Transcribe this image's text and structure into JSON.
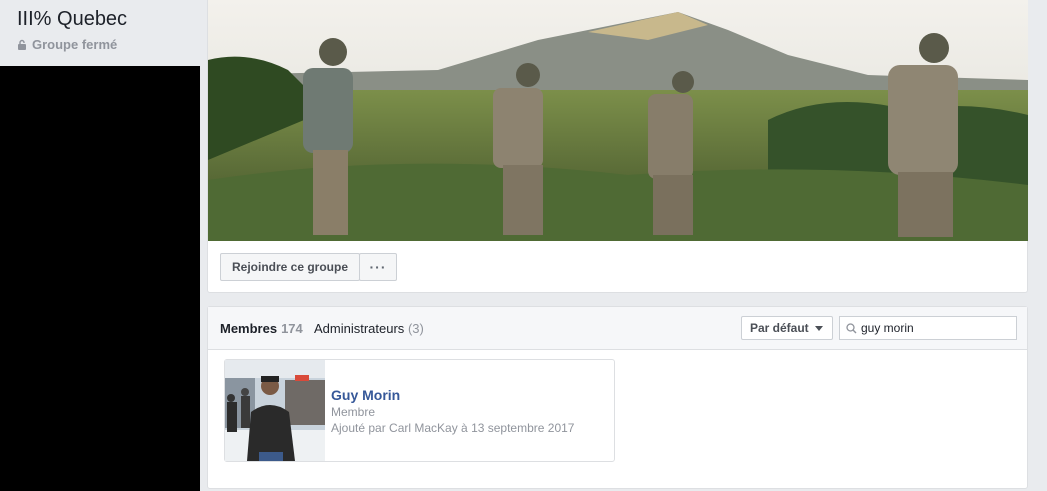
{
  "group": {
    "name": "III% Quebec",
    "privacy": "Groupe fermé",
    "join_label": "Rejoindre ce groupe",
    "more_label": "···"
  },
  "members": {
    "tab_members_label": "Membres",
    "members_count": "174",
    "tab_admins_label": "Administrateurs",
    "admins_count": "(3)",
    "sort_label": "Par défaut",
    "search_value": "guy morin",
    "results": [
      {
        "name": "Guy Morin",
        "role": "Membre",
        "added": "Ajouté par Carl MacKay à 13 septembre 2017"
      }
    ]
  },
  "icons": {
    "privacy": "lock-icon",
    "search": "search-icon",
    "sort": "chevron-down-icon"
  },
  "colors": {
    "link": "#365899",
    "page_bg": "#e9ebee",
    "secondary_text": "#90949c"
  }
}
